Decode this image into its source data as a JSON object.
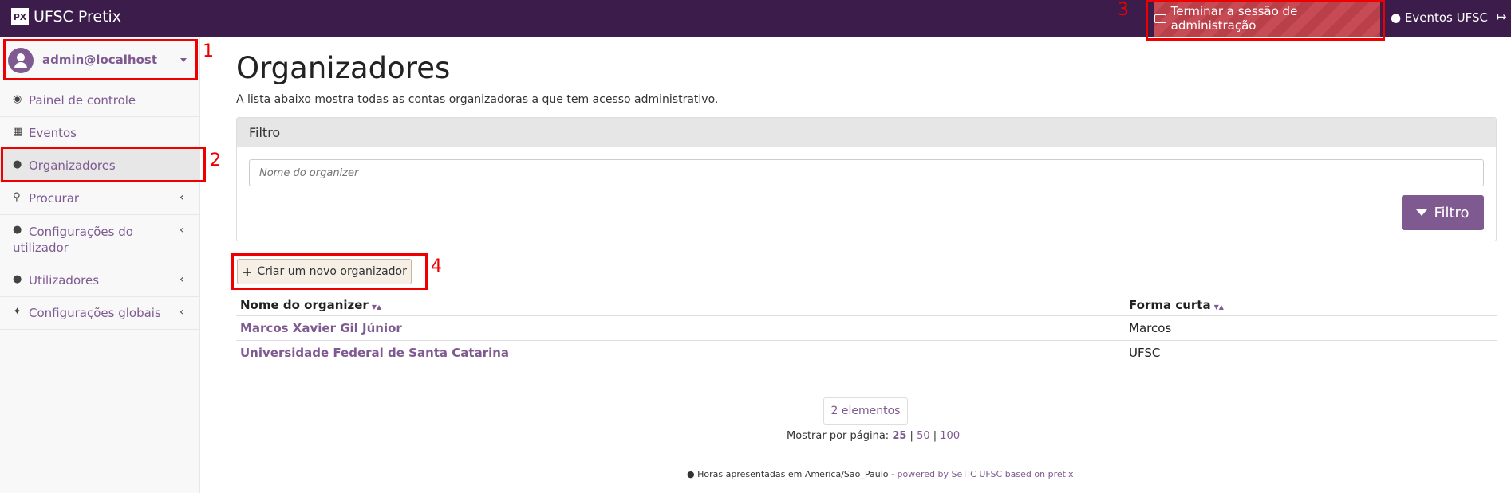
{
  "navbar": {
    "brand": "UFSC Pretix",
    "brand_logo": "PX",
    "admin_session": "Terminar a sessão de administração",
    "organizer_link": "Eventos UFSC"
  },
  "sidebar": {
    "user": "admin@localhost",
    "items": [
      {
        "label": "Painel de controle",
        "icon": "dashboard-icon"
      },
      {
        "label": "Eventos",
        "icon": "calendar-icon"
      },
      {
        "label": "Organizadores",
        "icon": "users-icon"
      },
      {
        "label": "Procurar",
        "icon": "search-icon"
      },
      {
        "label": "Configurações do utilizador",
        "icon": "user-icon"
      },
      {
        "label": "Utilizadores",
        "icon": "user-icon"
      },
      {
        "label": "Configurações globais",
        "icon": "wrench-icon"
      }
    ]
  },
  "main": {
    "title": "Organizadores",
    "description": "A lista abaixo mostra todas as contas organizadoras a que tem acesso administrativo.",
    "filter": {
      "heading": "Filtro",
      "placeholder": "Nome do organizer",
      "button": "Filtro"
    },
    "create_button": "Criar um novo organizador",
    "table": {
      "columns": [
        "Nome do organizer",
        "Forma curta"
      ],
      "rows": [
        {
          "name": "Marcos Xavier Gil Júnior",
          "short": "Marcos"
        },
        {
          "name": "Universidade Federal de Santa Catarina",
          "short": "UFSC"
        }
      ]
    },
    "pagination": {
      "count": "2 elementos",
      "per_page_label": "Mostrar por página:",
      "options": [
        "25",
        "50",
        "100"
      ]
    }
  },
  "footer": {
    "timezone": "Horas apresentadas em America/Sao_Paulo",
    "separator": " - ",
    "powered": "powered by SeTIC UFSC based on pretix"
  },
  "annotations": [
    "1",
    "2",
    "3",
    "4"
  ],
  "colors": {
    "navbar": "#3b1c4a",
    "accent": "#7f5a91",
    "annotation": "#ee0000"
  }
}
